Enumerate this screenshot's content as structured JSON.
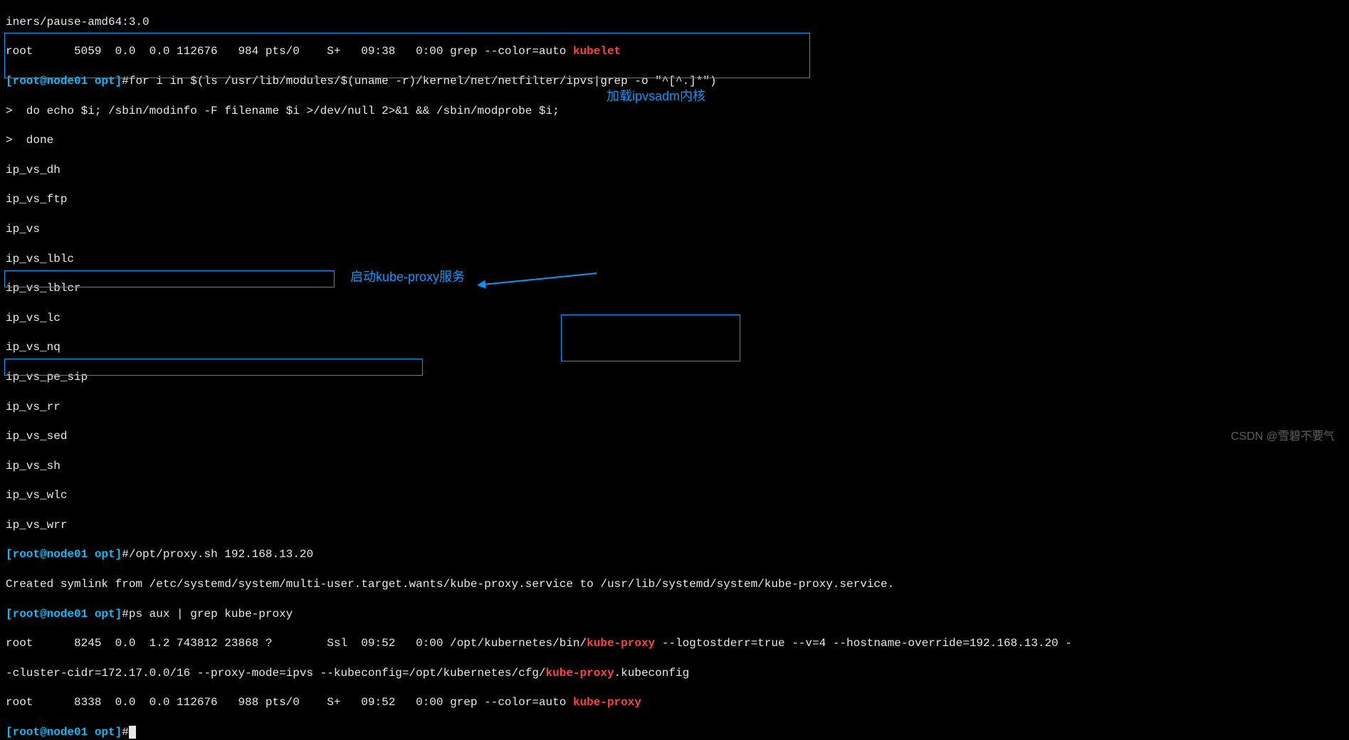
{
  "top_line": "iners/pause-amd64:3.0",
  "ps_line1": {
    "prefix": "root      5059  0.0  0.0 112676   984 pts/0    S+   09:38   0:00 grep --color=auto ",
    "highlight": "kubelet"
  },
  "prompt": {
    "user_host": "[root@node01 opt]",
    "hash": "#"
  },
  "cmd1_line1": "for i in $(ls /usr/lib/modules/$(uname -r)/kernel/net/netfilter/ipvs|grep -o \"^[^.]*\")",
  "cmd1_line2": ">  do echo $i; /sbin/modinfo -F filename $i >/dev/null 2>&1 && /sbin/modprobe $i;",
  "cmd1_line3": ">  done",
  "modules": [
    "ip_vs_dh",
    "ip_vs_ftp",
    "ip_vs",
    "ip_vs_lblc",
    "ip_vs_lblcr",
    "ip_vs_lc",
    "ip_vs_nq",
    "ip_vs_pe_sip",
    "ip_vs_rr",
    "ip_vs_sed",
    "ip_vs_sh",
    "ip_vs_wlc",
    "ip_vs_wrr"
  ],
  "cmd2": "/opt/proxy.sh 192.168.13.20",
  "symlink": "Created symlink from /etc/systemd/system/multi-user.target.wants/kube-proxy.service to /usr/lib/systemd/system/kube-proxy.service.",
  "cmd3": "ps aux | grep kube-proxy",
  "ps_line2": {
    "p1": "root      8245  0.0  1.2 743812 23868 ?        Ssl  09:52   0:00 /opt/kubernetes/bin/",
    "h1": "kube-proxy",
    "p2": " --logtostderr=true --v=4 --hostname-override=192.168.13.20 -"
  },
  "ps_line3": {
    "p1": "-cluster-cidr=172.17.0.0/16 --proxy-mode=ipvs --kubeconfig=/opt/kubernetes/cfg/",
    "h1": "kube-proxy",
    "p2": ".kubeconfig"
  },
  "ps_line4": {
    "p1": "root      8338  0.0  0.0 112676   988 pts/0    S+   09:52   0:00 grep --color=auto ",
    "h1": "kube-proxy"
  },
  "annot1": "加载ipvsadm内核",
  "annot2": "启动kube-proxy服务",
  "watermark": "CSDN @雪碧不要气"
}
